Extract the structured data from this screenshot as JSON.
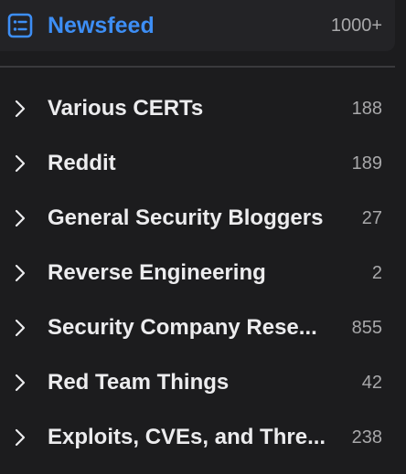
{
  "colors": {
    "background": "#1c1c1e",
    "accent": "#3d8ef5",
    "text": "#ececee",
    "muted": "#a8a8aa"
  },
  "newsfeed": {
    "icon": "list-icon",
    "label": "Newsfeed",
    "count": "1000+"
  },
  "folders": [
    {
      "icon": "chevron-right-icon",
      "label": "Various CERTs",
      "count": "188"
    },
    {
      "icon": "chevron-right-icon",
      "label": "Reddit",
      "count": "189"
    },
    {
      "icon": "chevron-right-icon",
      "label": "General Security Bloggers",
      "count": "27"
    },
    {
      "icon": "chevron-right-icon",
      "label": "Reverse Engineering",
      "count": "2"
    },
    {
      "icon": "chevron-right-icon",
      "label": "Security Company Rese...",
      "count": "855"
    },
    {
      "icon": "chevron-right-icon",
      "label": "Red Team Things",
      "count": "42"
    },
    {
      "icon": "chevron-right-icon",
      "label": "Exploits, CVEs, and Thre...",
      "count": "238"
    }
  ]
}
